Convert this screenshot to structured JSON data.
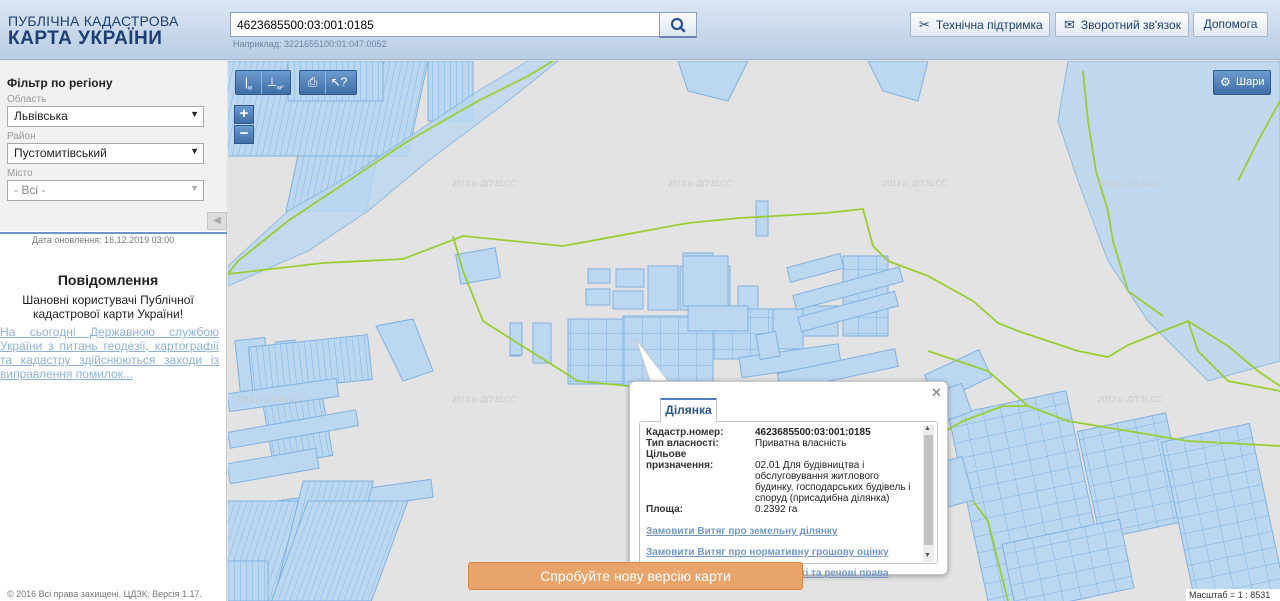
{
  "header": {
    "logo_line1": "ПУБЛІЧНА КАДАСТРОВА",
    "logo_line2": "КАРТА УКРАЇНИ",
    "search_value": "4623685500:03:001:0185",
    "search_example": "Наприклад: 3221655100:01:047:0052",
    "buttons": {
      "support": "Технічна підтримка",
      "feedback": "Зворотний зв'язок",
      "help": "Допомога"
    }
  },
  "sidebar": {
    "filter_title": "Фільтр по регіону",
    "oblast_label": "Область",
    "oblast_value": "Львівська",
    "rayon_label": "Район",
    "rayon_value": "Пустомитівський",
    "city_label": "Місто",
    "city_value": "- Всі -",
    "updated": "Дата оновлення: 16.12.2019 03:00",
    "notice_title": "Повідомлення",
    "notice_body": "Шановні користувачі Публічної кадастрової карти України!",
    "notice_link": "На сьогодні Державною службою України з питань геодезії, картографії та кадастру здійснюються заходи із виправлення помилок...",
    "copyright": "© 2016 Всі права захищені. ЦДЗК. Версія 1.17."
  },
  "map": {
    "layers_label": "Шари",
    "watermark": "2013 р. ДП SLCC",
    "scale": "Масштаб = 1 : 8531",
    "new_version": "Спробуйте нову версію карти",
    "colors": {
      "parcel_fill": "#bcd8f1",
      "parcel_stroke": "#7fb0e0",
      "boundary": "#9acd32"
    }
  },
  "popup": {
    "tab": "Ділянка",
    "fields": [
      {
        "key": "Кадастр.номер:",
        "value": "4623685500:03:001:0185"
      },
      {
        "key": "Тип власності:",
        "value": "Приватна власність"
      },
      {
        "key": "Цільове призначення:",
        "value": "02.01 Для будівництва і обслуговування житлового будинку, господарських будівель і споруд (присадибна ділянка)"
      },
      {
        "key": "Площа:",
        "value": "0.2392 га"
      }
    ],
    "links": [
      "Замовити Витяг про земельну ділянку",
      "Замовити Витяг про нормативну грошову оцінку",
      "Інформація про право власності та речові права"
    ]
  }
}
